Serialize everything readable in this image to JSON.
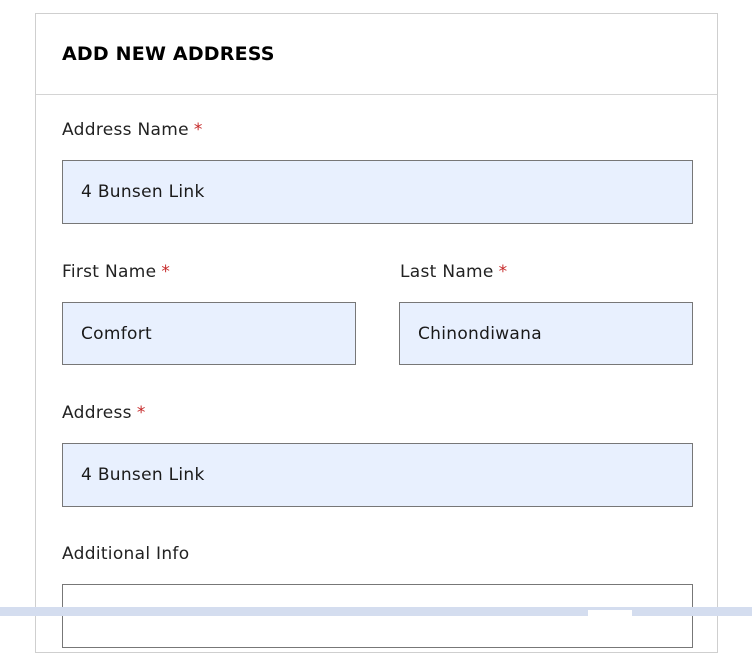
{
  "form": {
    "title": "ADD NEW ADDRESS",
    "required_marker": "*",
    "fields": {
      "address_name": {
        "label": "Address Name",
        "value": "4 Bunsen Link",
        "required": true
      },
      "first_name": {
        "label": "First Name",
        "value": "Comfort",
        "required": true
      },
      "last_name": {
        "label": "Last Name",
        "value": "Chinondiwana",
        "required": true
      },
      "address": {
        "label": "Address",
        "value": "4 Bunsen Link",
        "required": true
      },
      "additional_info": {
        "label": "Additional Info",
        "value": "",
        "required": false
      }
    }
  },
  "colors": {
    "autofill_bg": "#e8f0fe",
    "required": "#c62828",
    "border": "#777777"
  }
}
